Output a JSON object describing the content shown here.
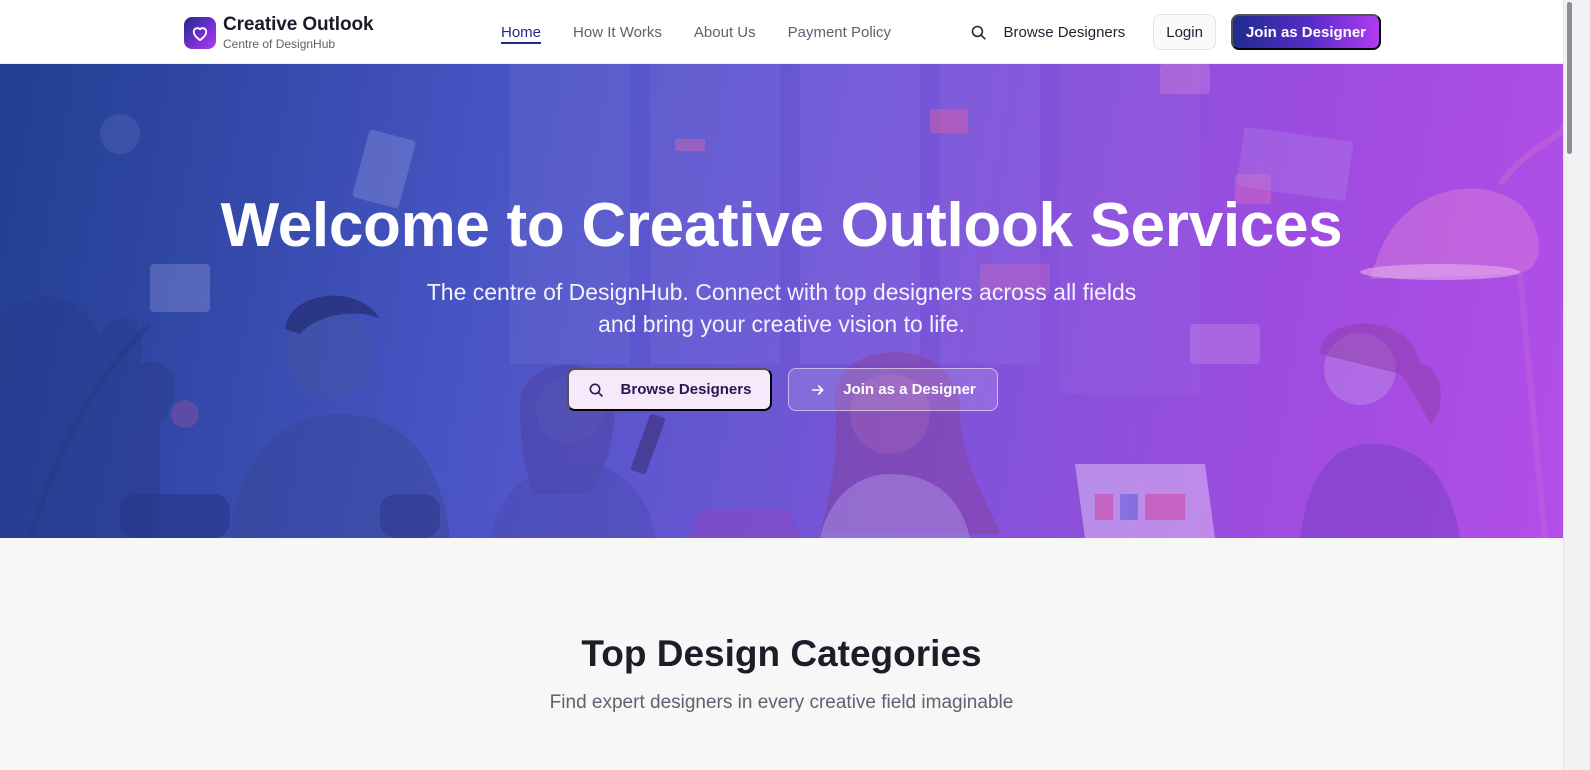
{
  "colors": {
    "brand_dark": "#1e2a8a",
    "brand_purple": "#7b2fd8",
    "brand_magenta": "#b03cf0",
    "hero_gradient_start": "#24428f",
    "hero_gradient_end": "#b44ee8",
    "page_background": "#f7f7f8"
  },
  "header": {
    "logo_icon": "heart-icon",
    "logo_title": "Creative Outlook",
    "logo_subtitle": "Centre of DesignHub",
    "nav": [
      {
        "label": "Home",
        "active": true
      },
      {
        "label": "How It Works",
        "active": false
      },
      {
        "label": "About Us",
        "active": false
      },
      {
        "label": "Payment Policy",
        "active": false
      }
    ],
    "search_icon": "search-icon",
    "browse_label": "Browse Designers",
    "login_label": "Login",
    "join_label": "Join as Designer"
  },
  "hero": {
    "title": "Welcome to Creative Outlook Services",
    "subtitle": "The centre of DesignHub. Connect with top designers across all fields and bring your creative vision to life.",
    "primary_button": {
      "label": "Browse Designers",
      "icon": "search-icon"
    },
    "secondary_button": {
      "label": "Join as a Designer",
      "icon": "arrow-right-icon"
    }
  },
  "categories": {
    "title": "Top Design Categories",
    "subtitle": "Find expert designers in every creative field imaginable"
  }
}
